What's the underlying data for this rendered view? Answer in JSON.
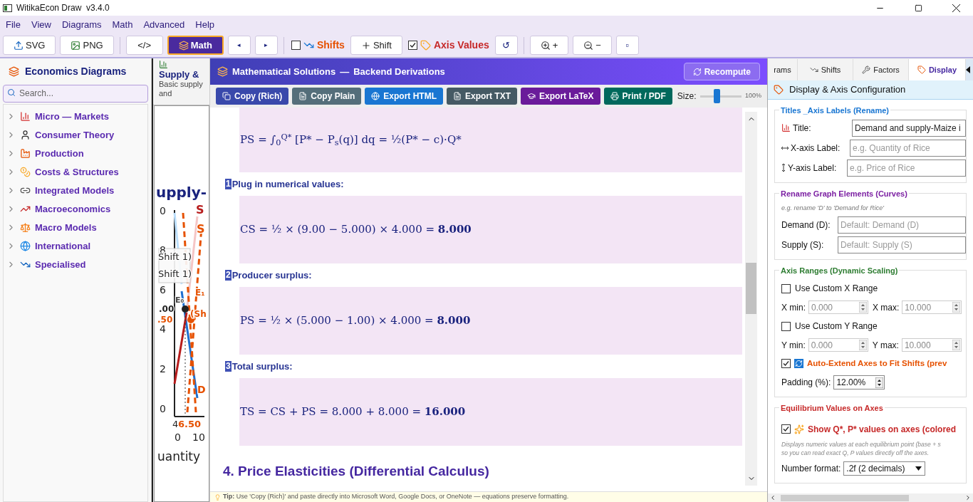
{
  "window": {
    "title": "WitikaEcon Draw  v3.4.0"
  },
  "menu": [
    "File",
    "View",
    "Diagrams",
    "Math",
    "Advanced",
    "Help"
  ],
  "toolbar": [
    {
      "kind": "button",
      "label": "SVG",
      "selected": false
    },
    {
      "kind": "button",
      "label": "PNG",
      "selected": false
    },
    {
      "kind": "sep"
    },
    {
      "kind": "button",
      "label": "</>",
      "selected": false
    },
    {
      "kind": "button",
      "label": "Math",
      "selected": true
    },
    {
      "kind": "button",
      "label": "◂",
      "selected": false
    },
    {
      "kind": "button",
      "label": "▸",
      "selected": false
    },
    {
      "kind": "sep"
    },
    {
      "kind": "check",
      "label": "Shifts",
      "checked": false,
      "color": "#e65100"
    },
    {
      "kind": "button",
      "label": "Shift",
      "selected": false
    },
    {
      "kind": "check",
      "label": "Axis Values",
      "checked": true,
      "color": "#c62828"
    },
    {
      "kind": "button",
      "label": "↺",
      "selected": false
    },
    {
      "kind": "sep"
    },
    {
      "kind": "button",
      "label": "+",
      "selected": false
    },
    {
      "kind": "button",
      "label": "−",
      "selected": false
    },
    {
      "kind": "button",
      "label": "▫",
      "selected": false
    }
  ],
  "sidebar": {
    "title": "Economics Diagrams",
    "search": {
      "placeholder": "Search..."
    },
    "items": [
      {
        "label": "Micro — Markets",
        "expanded": false
      },
      {
        "label": "Consumer Theory",
        "expanded": false
      },
      {
        "label": "Production",
        "expanded": false
      },
      {
        "label": "Costs & Structures",
        "expanded": false
      },
      {
        "label": "Integrated Models",
        "expanded": false
      },
      {
        "label": "Macroeconomics",
        "expanded": false
      },
      {
        "label": "Macro Models",
        "expanded": false
      },
      {
        "label": "International",
        "expanded": false
      },
      {
        "label": "Specialised",
        "expanded": false
      }
    ]
  },
  "diagram_card": {
    "title": "Supply &",
    "subtitle": "Basic supply and",
    "plot_labels": [
      "upply-",
      "S",
      "0",
      "S",
      "8",
      "Shift 1)",
      "Shift 1)",
      "6",
      "E₁",
      "E₀",
      ".00",
      "(Sh",
      ".50",
      "4",
      "2",
      "D",
      "0",
      "4",
      "6.50",
      "0",
      "10",
      "uantity"
    ]
  },
  "math_panel": {
    "title": "Mathematical Solutions",
    "dash": "—",
    "subtitle": "Backend Derivations",
    "recompute": "Recompute",
    "actions": [
      {
        "label": "Copy (Rich)",
        "color": "#3949ab"
      },
      {
        "label": "Copy Plain",
        "color": "#546e7a"
      },
      {
        "label": "Export HTML",
        "color": "#1976d2"
      },
      {
        "label": "Export TXT",
        "color": "#455a64"
      },
      {
        "label": "Export LaTeX",
        "color": "#6a1b9a"
      },
      {
        "label": "Print / PDF",
        "color": "#00695c"
      }
    ],
    "size": {
      "label": "Size:",
      "level": 0.4,
      "reading": "100%"
    },
    "content": [
      {
        "kind": "formula",
        "text": "PS = ∫$_{0}$$^{Q*}$ [P* − P$_{s}$(q)] dq = ½(P* − c)·Q*"
      },
      {
        "kind": "step",
        "number": "1",
        "label": "Plug in numerical values:"
      },
      {
        "kind": "formula",
        "text": "CS = ½ × (9.00 − 5.000) × 4.000 = **8.000**"
      },
      {
        "kind": "step",
        "number": "2",
        "label": "Producer surplus:"
      },
      {
        "kind": "formula",
        "text": "PS = ½ × (5.000 − 1.00) × 4.000 = **8.000**"
      },
      {
        "kind": "step",
        "number": "3",
        "label": "Total surplus:"
      },
      {
        "kind": "formula",
        "text": "TS = CS + PS = 8.000 + 8.000 = **16.000**"
      },
      {
        "kind": "heading",
        "label": "4. Price Elasticities (Differential Calculus)"
      }
    ],
    "tip": "**Tip:** Use 'Copy (Rich)' and paste directly into Microsoft Word, Google Docs, or OneNote — equations preserve formatting."
  },
  "settings": {
    "tabs": [
      {
        "label": "rams",
        "selected": false
      },
      {
        "label": "Shifts",
        "selected": false
      },
      {
        "label": "Factors",
        "selected": false
      },
      {
        "label": "Display",
        "selected": true
      }
    ],
    "header": "Display & Axis Configuration",
    "titles": {
      "legend": "Titles _Axis Labels (Rename)",
      "fields": [
        {
          "label": "Title:",
          "value": "Demand and supply-Maize i"
        },
        {
          "label": "X-axis Label:",
          "placeholder": "e.g. Quantity of Rice"
        },
        {
          "label": "Y-axis Label:",
          "placeholder": "e.g. Price of Rice"
        }
      ]
    },
    "curves": {
      "legend": "Rename Graph Elements (Curves)",
      "hint": "e.g. rename 'D' to 'Demand for Rice'",
      "fields": [
        {
          "label": "Demand (D):",
          "placeholder": "Default: Demand (D)"
        },
        {
          "label": "Supply (S):",
          "placeholder": "Default: Supply (S)"
        }
      ]
    },
    "ranges": {
      "legend": "Axis Ranges (Dynamic Scaling)",
      "custom_x": {
        "label": "Use Custom X Range",
        "checked": false
      },
      "x_min": {
        "label": "X min:",
        "value": "0.000"
      },
      "x_max": {
        "label": "X max:",
        "value": "10.000"
      },
      "custom_y": {
        "label": "Use Custom Y Range",
        "checked": false
      },
      "y_min": {
        "label": "Y min:",
        "value": "0.000"
      },
      "y_max": {
        "label": "Y max:",
        "value": "10.000"
      },
      "auto_extend": {
        "label": "Auto-Extend Axes to Fit Shifts (prev",
        "checked": true
      },
      "padding": {
        "label": "Padding (%):",
        "value": "12.00%"
      }
    },
    "equilibrium": {
      "legend": "Equilibrium Values on Axes",
      "show": {
        "label": "Show Q*, P* values on axes (colored",
        "checked": true
      },
      "hint": [
        "Displays numeric values at each equilibrium point (base + s",
        "so you can read exact Q, P values directly off the axes."
      ],
      "format": {
        "label": "Number format:",
        "value": ".2f (2 decimals)"
      }
    }
  }
}
